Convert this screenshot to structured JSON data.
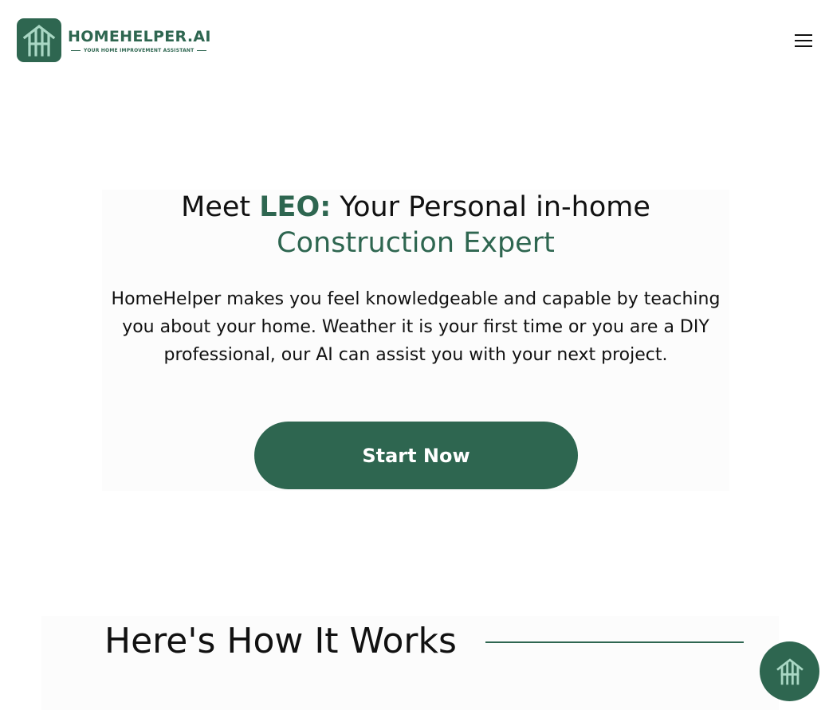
{
  "brand": {
    "name": "HOMEHELPER.AI",
    "tagline": "YOUR HOME IMPROVEMENT ASSISTANT",
    "logo_icon": "house-frame-icon",
    "color": "#2e6650"
  },
  "header": {
    "menu_icon": "hamburger-menu-icon"
  },
  "hero": {
    "title_part1": "Meet ",
    "title_leo": "LEO:",
    "title_part2": " Your Personal in-home",
    "title_line2": "Construction Expert",
    "description": "HomeHelper makes you feel knowledgeable and capable by teaching you about your home. Weather it is your first time or you are a DIY professional, our AI can assist you with your next project.",
    "cta_label": "Start Now"
  },
  "how_it_works": {
    "title": "Here's How It Works"
  },
  "chat": {
    "icon": "house-frame-icon"
  }
}
